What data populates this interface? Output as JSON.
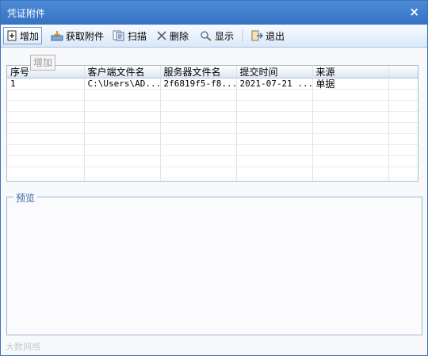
{
  "window": {
    "title": "凭证附件",
    "close_symbol": "×"
  },
  "toolbar": {
    "add": "增加",
    "fetch": "获取附件",
    "scan": "扫描",
    "delete": "删除",
    "show": "显示",
    "exit": "退出"
  },
  "tooltip": {
    "text": "增加"
  },
  "table": {
    "columns": [
      "序号",
      "客户端文件名",
      "服务器文件名",
      "提交时间",
      "来源",
      ""
    ],
    "rows": [
      {
        "index": "1",
        "client_file": "C:\\Users\\AD...",
        "server_file": "2f6819f5-f8...",
        "submit_time": "2021-07-21 ...",
        "source": "单据",
        "extra": ""
      }
    ]
  },
  "preview": {
    "legend": "预览"
  },
  "watermark": {
    "text": "大数网络"
  }
}
